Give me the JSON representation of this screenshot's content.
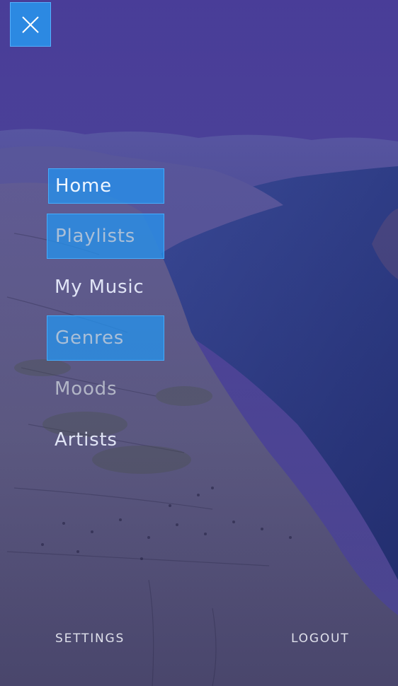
{
  "close_button": {
    "icon": "close-icon",
    "color": "#2797EE"
  },
  "menu": {
    "items": [
      {
        "label": "Home",
        "highlighted": true
      },
      {
        "label": "Playlists",
        "highlighted": true
      },
      {
        "label": "My Music",
        "highlighted": false
      },
      {
        "label": "Genres",
        "highlighted": true
      },
      {
        "label": "Moods",
        "highlighted": false
      },
      {
        "label": "Artists",
        "highlighted": false
      }
    ]
  },
  "footer": {
    "settings_label": "SETTINGS",
    "logout_label": "LOGOUT"
  },
  "colors": {
    "overlay": "#5a4fa8",
    "highlight": "#2196F3",
    "water": "#2a3f8c"
  }
}
